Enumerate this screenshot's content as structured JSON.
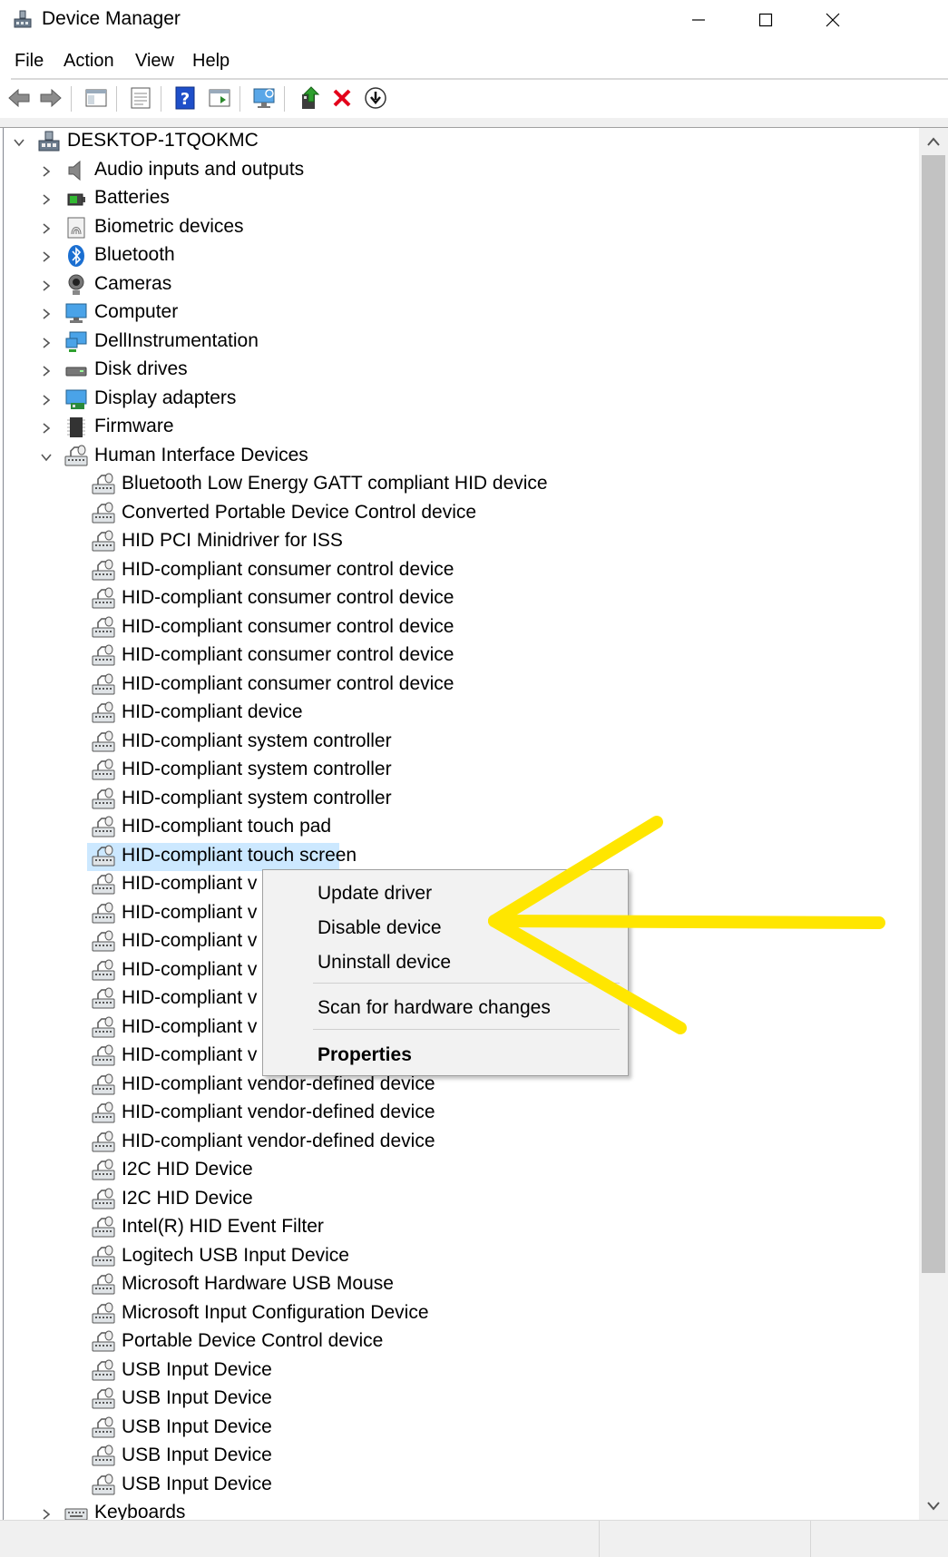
{
  "window": {
    "title": "Device Manager",
    "controls": [
      "minimize-icon",
      "maximize-icon",
      "close-icon"
    ]
  },
  "menu": [
    "File",
    "Action",
    "View",
    "Help"
  ],
  "toolbar": {
    "buttons": [
      "back-arrow-icon",
      "forward-arrow-icon",
      "show-hide-console-tree-icon",
      "properties-icon",
      "help-icon",
      "action-pane-icon",
      "scan-hardware-icon",
      "update-driver-icon",
      "uninstall-device-icon",
      "disable-device-icon"
    ]
  },
  "tree": {
    "root": "DESKTOP-1TQOKMC",
    "categories": [
      {
        "label": "Audio inputs and outputs",
        "icon": "speaker-icon"
      },
      {
        "label": "Batteries",
        "icon": "battery-icon"
      },
      {
        "label": "Biometric devices",
        "icon": "fingerprint-icon"
      },
      {
        "label": "Bluetooth",
        "icon": "bluetooth-icon"
      },
      {
        "label": "Cameras",
        "icon": "camera-icon"
      },
      {
        "label": "Computer",
        "icon": "computer-icon"
      },
      {
        "label": "DellInstrumentation",
        "icon": "network-computer-icon"
      },
      {
        "label": "Disk drives",
        "icon": "disk-drive-icon"
      },
      {
        "label": "Display adapters",
        "icon": "display-adapter-icon"
      },
      {
        "label": "Firmware",
        "icon": "firmware-chip-icon"
      }
    ],
    "expanded_category": "Human Interface Devices",
    "hid_devices": [
      "Bluetooth Low Energy GATT compliant HID device",
      "Converted Portable Device Control device",
      "HID PCI Minidriver for ISS",
      "HID-compliant consumer control device",
      "HID-compliant consumer control device",
      "HID-compliant consumer control device",
      "HID-compliant consumer control device",
      "HID-compliant consumer control device",
      "HID-compliant device",
      "HID-compliant system controller",
      "HID-compliant system controller",
      "HID-compliant system controller",
      "HID-compliant touch pad",
      "HID-compliant touch screen",
      "HID-compliant v",
      "HID-compliant v",
      "HID-compliant v",
      "HID-compliant v",
      "HID-compliant v",
      "HID-compliant v",
      "HID-compliant v",
      "HID-compliant vendor-defined device",
      "HID-compliant vendor-defined device",
      "HID-compliant vendor-defined device",
      "I2C HID Device",
      "I2C HID Device",
      "Intel(R) HID Event Filter",
      "Logitech USB Input Device",
      "Microsoft Hardware USB Mouse",
      "Microsoft Input Configuration Device",
      "Portable Device Control device",
      "USB Input Device",
      "USB Input Device",
      "USB Input Device",
      "USB Input Device",
      "USB Input Device"
    ],
    "selected_device": "HID-compliant touch screen",
    "next_category": "Keyboards"
  },
  "context_menu": {
    "items": [
      "Update driver",
      "Disable device",
      "Uninstall device",
      "Scan for hardware changes",
      "Properties"
    ]
  },
  "annotation": {
    "color": "#ffe600",
    "icon": "yellow-arrow-icon"
  }
}
